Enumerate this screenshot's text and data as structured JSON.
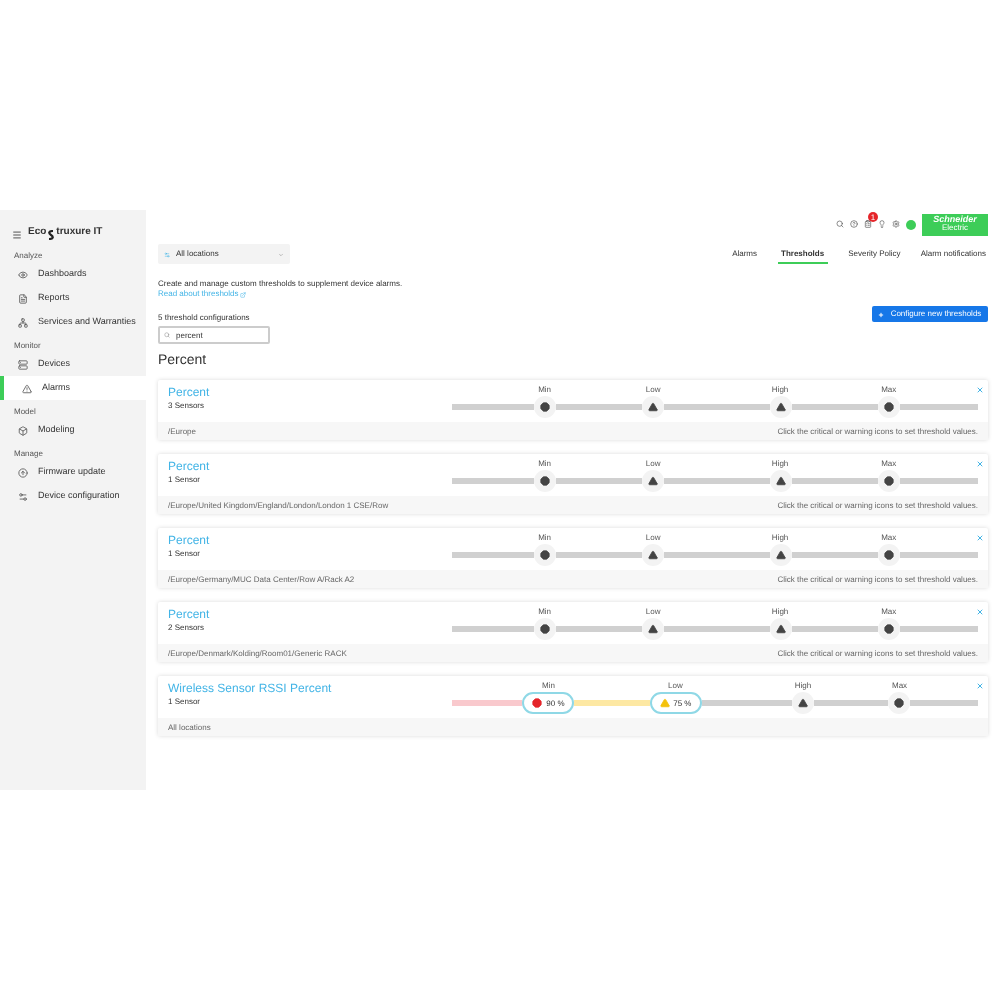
{
  "sidebar": {
    "brand_prefix": "Eco",
    "brand_suffix": "truxure IT",
    "sections": [
      {
        "title": "Analyze",
        "items": [
          {
            "label": "Dashboards",
            "selected": false
          },
          {
            "label": "Reports",
            "selected": false
          },
          {
            "label": "Services and Warranties",
            "selected": false
          }
        ]
      },
      {
        "title": "Monitor",
        "items": [
          {
            "label": "Devices",
            "selected": false
          },
          {
            "label": "Alarms",
            "selected": true
          }
        ]
      },
      {
        "title": "Model",
        "items": [
          {
            "label": "Modeling",
            "selected": false
          }
        ]
      },
      {
        "title": "Manage",
        "items": [
          {
            "label": "Firmware update",
            "selected": false
          },
          {
            "label": "Device configuration",
            "selected": false
          }
        ]
      }
    ]
  },
  "topbar": {
    "notification_badge": "1",
    "logo": "Schneider",
    "logo_sub": "Electric"
  },
  "location": {
    "value": "All locations"
  },
  "tabs": [
    {
      "label": "Alarms",
      "selected": false
    },
    {
      "label": "Thresholds",
      "selected": true
    },
    {
      "label": "Severity Policy",
      "selected": false
    },
    {
      "label": "Alarm notifications",
      "selected": false
    }
  ],
  "description": "Create and manage custom thresholds to supplement device alarms.",
  "link": "Read about thresholds",
  "count": "5 threshold configurations",
  "configure_button": "Configure new thresholds",
  "search": {
    "value": "percent"
  },
  "group_title": "Percent",
  "cards": [
    {
      "title": "Percent",
      "sensors": "3 Sensors",
      "location": "/Europe",
      "hint": "Click the critical or warning icons to set threshold values.",
      "markers": [
        {
          "label": "Min",
          "kind": "critical"
        },
        {
          "label": "Low",
          "kind": "warning"
        },
        {
          "label": "High",
          "kind": "warning"
        },
        {
          "label": "Max",
          "kind": "critical"
        }
      ]
    },
    {
      "title": "Percent",
      "sensors": "1 Sensor",
      "location": "/Europe/United Kingdom/England/London/London 1 CSE/Row",
      "hint": "Click the critical or warning icons to set threshold values.",
      "markers": [
        {
          "label": "Min",
          "kind": "critical"
        },
        {
          "label": "Low",
          "kind": "warning"
        },
        {
          "label": "High",
          "kind": "warning"
        },
        {
          "label": "Max",
          "kind": "critical"
        }
      ]
    },
    {
      "title": "Percent",
      "sensors": "1 Sensor",
      "location": "/Europe/Germany/MUC Data Center/Row A/Rack A2",
      "hint": "Click the critical or warning icons to set threshold values.",
      "markers": [
        {
          "label": "Min",
          "kind": "critical"
        },
        {
          "label": "Low",
          "kind": "warning"
        },
        {
          "label": "High",
          "kind": "warning"
        },
        {
          "label": "Max",
          "kind": "critical"
        }
      ]
    },
    {
      "title": "Percent",
      "sensors": "2 Sensors",
      "location": "/Europe/Denmark/Kolding/Room01/Generic RACK",
      "hint": "Click the critical or warning icons to set threshold values.",
      "markers": [
        {
          "label": "Min",
          "kind": "critical"
        },
        {
          "label": "Low",
          "kind": "warning"
        },
        {
          "label": "High",
          "kind": "warning"
        },
        {
          "label": "Max",
          "kind": "critical"
        }
      ]
    },
    {
      "title": "Wireless Sensor RSSI Percent",
      "sensors": "1 Sensor",
      "location": "All locations",
      "markers": [
        {
          "label": "Min",
          "kind": "critical",
          "value": "90 %"
        },
        {
          "label": "Low",
          "kind": "warning",
          "value": "75 %"
        },
        {
          "label": "High",
          "kind": "warning"
        },
        {
          "label": "Max",
          "kind": "critical"
        }
      ]
    }
  ]
}
